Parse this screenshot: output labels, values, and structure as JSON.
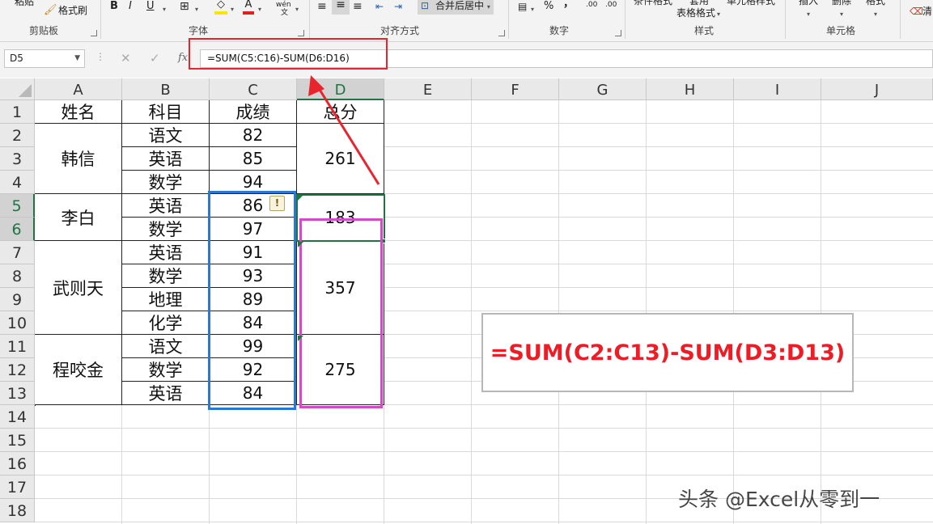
{
  "ribbon": {
    "clipboard": {
      "paste": "粘贴",
      "format_painter": "格式刷",
      "group": "剪贴板"
    },
    "font": {
      "bold": "B",
      "italic": "I",
      "underline": "U",
      "font_color": "A",
      "phonetic": "wén",
      "group": "字体"
    },
    "alignment": {
      "merge_center": "合并后居中",
      "group": "对齐方式"
    },
    "number": {
      "percent": "%",
      "comma": "，",
      "inc_decimal": ".00",
      "dec_decimal": ".00",
      "group": "数字"
    },
    "styles": {
      "conditional": "条件格式",
      "as_table_top": "套用",
      "as_table": "表格格式",
      "cell_styles": "单元格样式",
      "group": "样式"
    },
    "cells": {
      "insert": "插入",
      "delete": "删除",
      "format": "格式",
      "group": "单元格"
    },
    "clear": "清"
  },
  "formula_bar": {
    "name_box": "D5",
    "fx": "fx",
    "formula": "=SUM(C5:C16)-SUM(D6:D16)"
  },
  "columns": [
    "A",
    "B",
    "C",
    "D",
    "E",
    "F",
    "G",
    "H",
    "I",
    "J"
  ],
  "rows": [
    "1",
    "2",
    "3",
    "4",
    "5",
    "6",
    "7",
    "8",
    "9",
    "10",
    "11",
    "12",
    "13",
    "14",
    "15",
    "16",
    "17",
    "18"
  ],
  "table": {
    "headers": {
      "name": "姓名",
      "subject": "科目",
      "score": "成绩",
      "total": "总分"
    },
    "groups": [
      {
        "name": "韩信",
        "total": "261",
        "rows": [
          {
            "subject": "语文",
            "score": "82"
          },
          {
            "subject": "英语",
            "score": "85"
          },
          {
            "subject": "数学",
            "score": "94"
          }
        ]
      },
      {
        "name": "李白",
        "total": "183",
        "rows": [
          {
            "subject": "英语",
            "score": "86"
          },
          {
            "subject": "数学",
            "score": "97"
          }
        ]
      },
      {
        "name": "武则天",
        "total": "357",
        "rows": [
          {
            "subject": "英语",
            "score": "91"
          },
          {
            "subject": "数学",
            "score": "93"
          },
          {
            "subject": "地理",
            "score": "89"
          },
          {
            "subject": "化学",
            "score": "84"
          }
        ]
      },
      {
        "name": "程咬金",
        "total": "275",
        "rows": [
          {
            "subject": "语文",
            "score": "99"
          },
          {
            "subject": "数学",
            "score": "92"
          },
          {
            "subject": "英语",
            "score": "84"
          }
        ]
      }
    ]
  },
  "callout_formula": "=SUM(C2:C13)-SUM(D3:D13)",
  "watermark": "头条 @Excel从零到一",
  "colors": {
    "annotation_red": "#ee1c25",
    "blue_box": "#2a77d6",
    "pink_box": "#d548c8",
    "selection_green": "#217346"
  }
}
